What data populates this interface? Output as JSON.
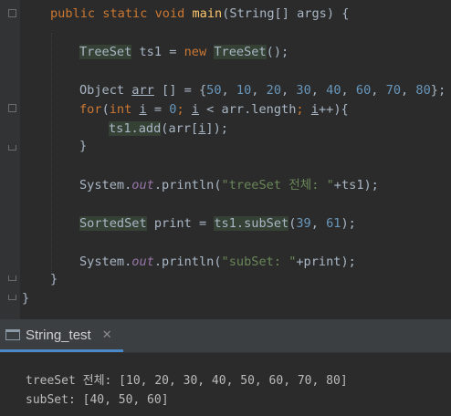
{
  "editor": {
    "lines": {
      "l1": {
        "kw": "public static void ",
        "fn": "main",
        "rest": "(String[] args) {"
      },
      "l2": {
        "type1": "TreeSet",
        "var": " ts1 = ",
        "kw": "new ",
        "type2": "TreeSet",
        "rest": "();"
      },
      "l3": {
        "pre": "Object ",
        "arr": "arr",
        "mid": " [] = {",
        "nums": [
          "50",
          "10",
          "20",
          "30",
          "40",
          "60",
          "70",
          "80"
        ],
        "end": "};"
      },
      "l4": {
        "kw_for": "for",
        "p1": "(",
        "kw_int": "int",
        "sp": " ",
        "i1": "i",
        "eq": " = ",
        "zero": "0",
        "semi1": "; ",
        "i2": "i",
        "cmp": " < arr.length",
        "semi2": "; ",
        "i3": "i",
        "inc": "++){"
      },
      "l5": {
        "call": "ts1.add",
        "arg": "(arr[",
        "i": "i",
        "close": "]);"
      },
      "l6": {
        "text": "}"
      },
      "l7": {
        "pre": "System.",
        "out": "out",
        "mid": ".println(",
        "str": "\"treeSet 전체: \"",
        "end": "+ts1);"
      },
      "l8": {
        "type": "SortedSet",
        "var": " print = ",
        "call": "ts1.subSet",
        "p": "(",
        "a": "39",
        "c": ", ",
        "b": "61",
        "end": ");"
      },
      "l9": {
        "pre": "System.",
        "out": "out",
        "mid": ".println(",
        "str": "\"subSet: \"",
        "end": "+print);"
      },
      "l10": {
        "text": "}"
      },
      "l11": {
        "text": "}"
      }
    }
  },
  "run_panel": {
    "tab_label": "String_test",
    "tab_close": "✕",
    "output": [
      "treeSet 전체: [10, 20, 30, 40, 50, 60, 70, 80]",
      "subSet: [40, 50, 60]"
    ]
  }
}
